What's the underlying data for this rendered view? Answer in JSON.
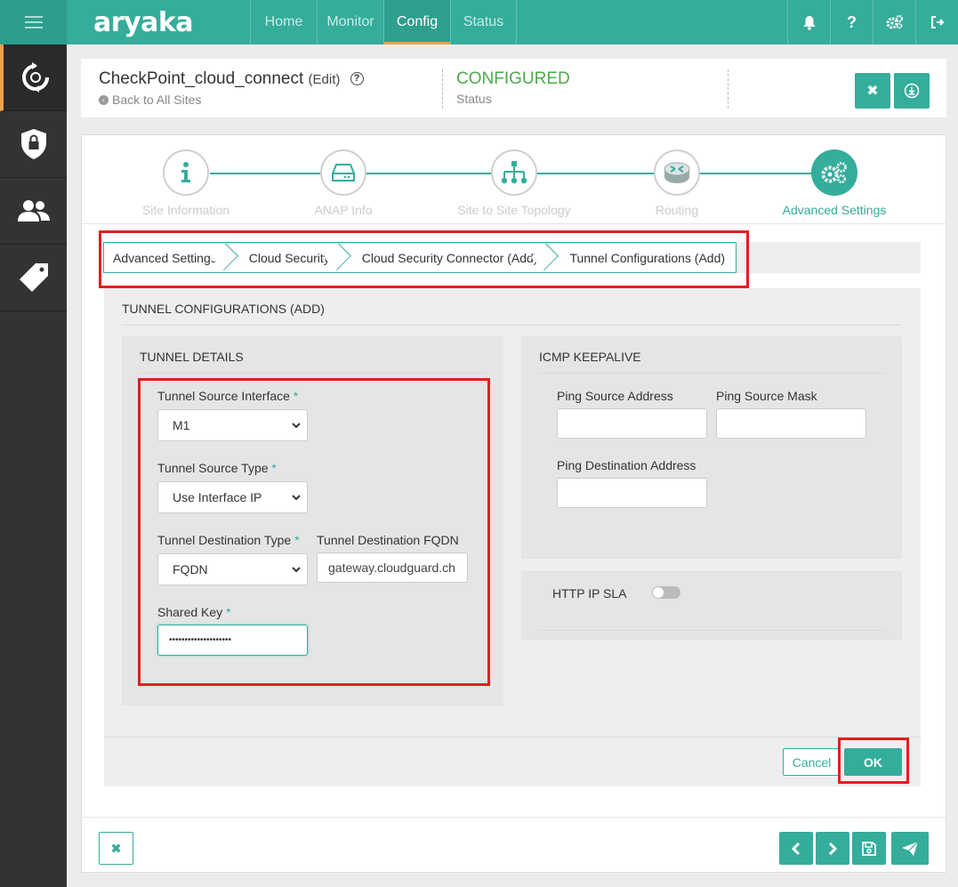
{
  "app": {
    "logo": "aryaka"
  },
  "nav": [
    {
      "label": "Home"
    },
    {
      "label": "Monitor"
    },
    {
      "label": "Config"
    },
    {
      "label": "Status"
    }
  ],
  "top_icons": {
    "bell": "bell-icon",
    "help": "?",
    "settings": "gears-icon",
    "logout": "logout-icon"
  },
  "sidebar": [
    "sync-icon",
    "shield-lock-icon",
    "users-icon",
    "tags-icon"
  ],
  "header": {
    "site_name": "CheckPoint_cloud_connect",
    "edit_label": "(Edit)",
    "back_link": "Back to All Sites",
    "status_value": "CONFIGURED",
    "status_label": "Status",
    "close_symbol": "✖",
    "download_symbol": "⤓"
  },
  "steps": [
    {
      "label": "Site Information"
    },
    {
      "label": "ANAP Info"
    },
    {
      "label": "Site to Site Topology"
    },
    {
      "label": "Routing"
    },
    {
      "label": "Advanced Settings"
    }
  ],
  "breadcrumb": [
    "Advanced Settings",
    "Cloud Security",
    "Cloud Security Connector (Add)",
    "Tunnel Configurations (Add)"
  ],
  "form": {
    "title": "TUNNEL CONFIGURATIONS (ADD)",
    "tunnel_details": {
      "title": "TUNNEL DETAILS",
      "source_interface_label": "Tunnel Source Interface",
      "source_interface_value": "M1",
      "source_type_label": "Tunnel Source Type",
      "source_type_value": "Use Interface IP",
      "dest_type_label": "Tunnel Destination Type",
      "dest_type_value": "FQDN",
      "dest_fqdn_label": "Tunnel Destination FQDN",
      "dest_fqdn_value": "gateway.cloudguard.ch",
      "shared_key_label": "Shared Key",
      "shared_key_value": "••••••••••••••••••••",
      "required_mark": "*"
    },
    "icmp": {
      "title": "ICMP KEEPALIVE",
      "ping_source_address_label": "Ping Source Address",
      "ping_source_mask_label": "Ping Source Mask",
      "ping_dest_address_label": "Ping Destination Address"
    },
    "http_sla": {
      "label": "HTTP IP SLA",
      "enabled": false
    },
    "cancel_label": "Cancel",
    "ok_label": "OK"
  },
  "bottom": {
    "close_symbol": "✖",
    "prev_symbol": "‹",
    "next_symbol": "›"
  },
  "colors": {
    "brand": "#35ad9b",
    "accent": "#f0a24a",
    "status_ok": "#4caa48",
    "highlight": "#e21f1f"
  }
}
